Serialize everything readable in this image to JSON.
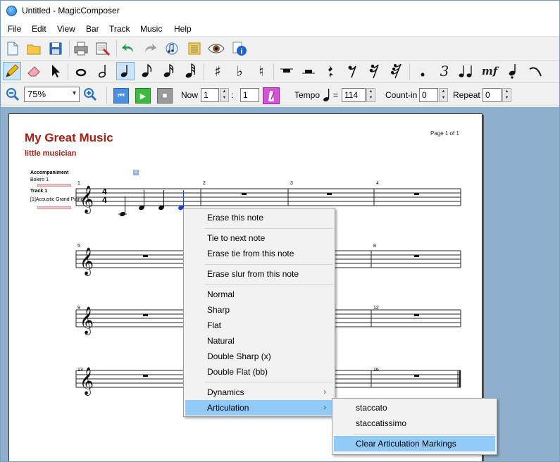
{
  "window": {
    "title": "Untitled - MagicComposer"
  },
  "menu": [
    "File",
    "Edit",
    "View",
    "Bar",
    "Track",
    "Music",
    "Help"
  ],
  "toolbar": {
    "zoom": "75%",
    "now_label": "Now",
    "now_bar": "1",
    "now_separator": ":",
    "now_beat": "1",
    "tempo_label": "Tempo",
    "tempo_equals": "=",
    "tempo_value": "114",
    "countin_label": "Count-in",
    "countin_value": "0",
    "repeat_label": "Repeat",
    "repeat_value": "0",
    "mf_label": "mf"
  },
  "score": {
    "title": "My Great Music",
    "composer": "little musician",
    "page_label": "Page 1 of 1",
    "accompaniment_label": "Accompaniment",
    "accompaniment_track": "Bolero 1",
    "track_label": "Track 1",
    "track_instrument": "[1]Acoustic Grand Piano",
    "marker": "A",
    "bar_numbers": [
      "1",
      "2",
      "3",
      "4",
      "5",
      "8",
      "9",
      "12",
      "13",
      "16"
    ],
    "time_signature": {
      "top": "4",
      "bottom": "4"
    }
  },
  "context_menu": {
    "items": {
      "erase_note": "Erase this note",
      "tie_next": "Tie to next note",
      "erase_tie": "Erase tie from this note",
      "erase_slur": "Erase slur from this note",
      "normal": "Normal",
      "sharp": "Sharp",
      "flat": "Flat",
      "natural": "Natural",
      "double_sharp": "Double Sharp (x)",
      "double_flat": "Double Flat (bb)",
      "dynamics": "Dynamics",
      "articulation": "Articulation"
    },
    "submenu": {
      "staccato": "staccato",
      "staccatissimo": "staccatissimo",
      "clear": "Clear Articulation Markings"
    }
  }
}
